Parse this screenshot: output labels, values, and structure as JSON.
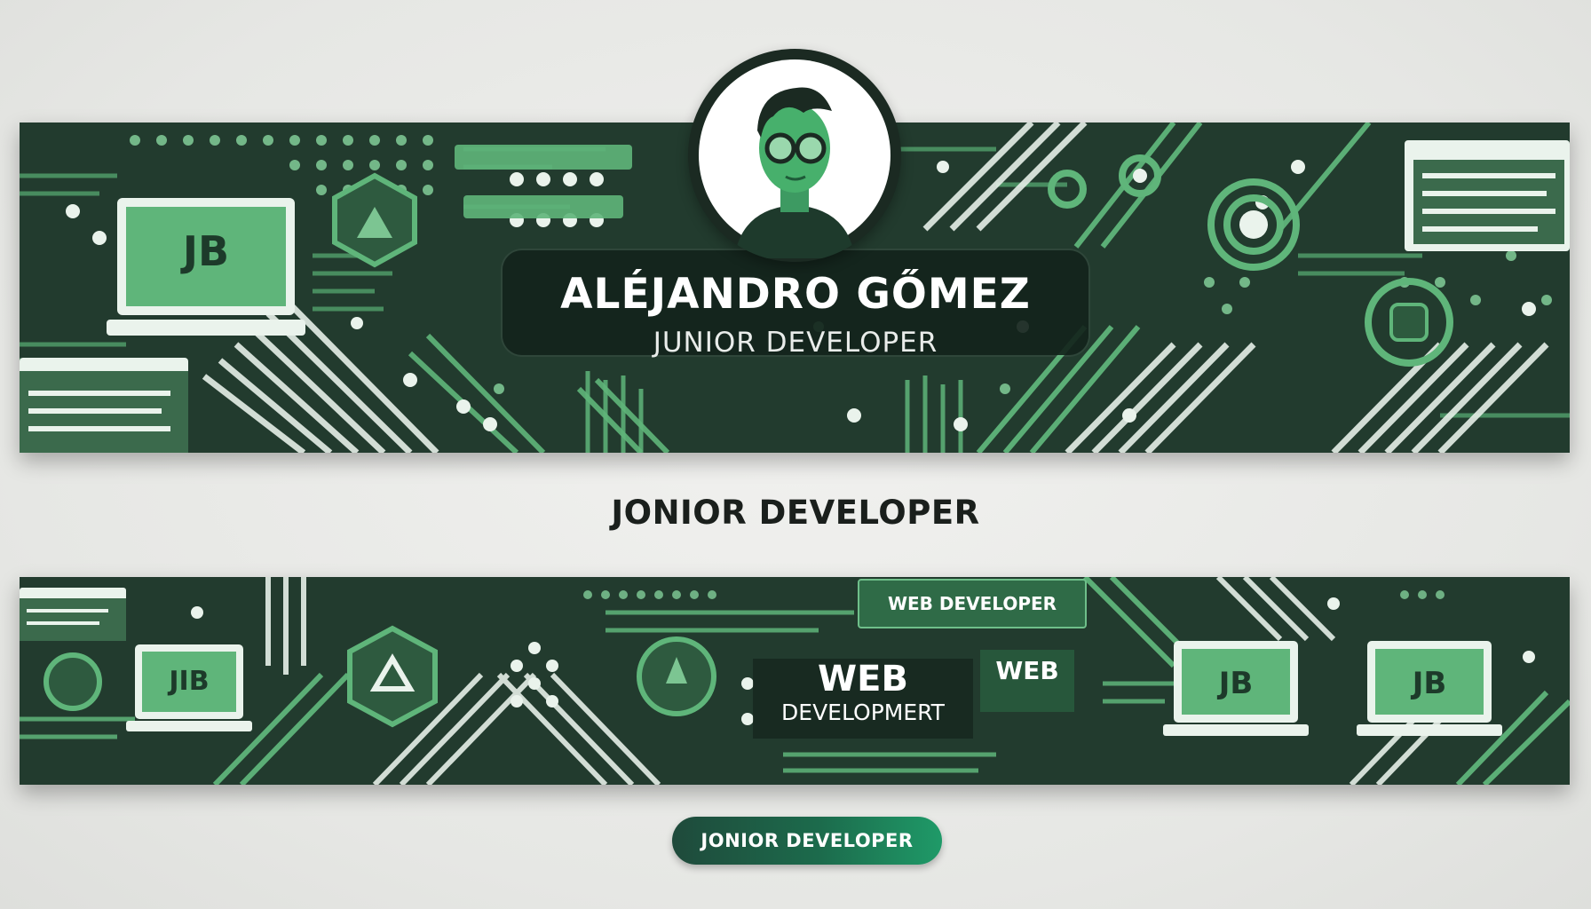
{
  "profile": {
    "name": "ALÉJANDRO GŐMEZ",
    "role": "JUNIOR DEVELOPER"
  },
  "top_banner": {
    "laptop_monogram": "JB"
  },
  "caption": "JONIOR DEVELOPER",
  "bottom_banner": {
    "web_developer_label": "WEB DEVELOPER",
    "web_label": "WEB",
    "web_development_line1": "WEB",
    "web_development_line2": "DEVELOPMERT",
    "laptop_monograms": [
      "JIB",
      "JB",
      "JB"
    ]
  },
  "pill_button": "JONIOR DEVELOPER",
  "colors": {
    "banner_dark": "#223b2e",
    "circuit_green": "#5fb57a",
    "circuit_light": "#e8f2ea",
    "pill_gradient_end": "#1f9a68"
  }
}
